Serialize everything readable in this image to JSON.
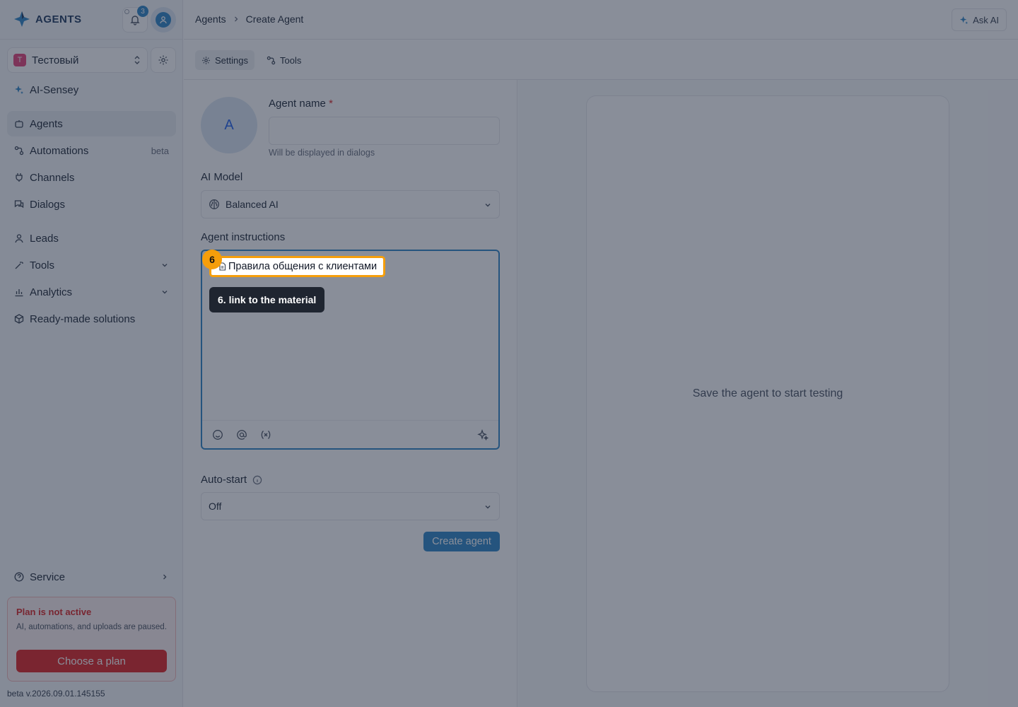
{
  "app": {
    "logo_text": "AGENTS"
  },
  "header": {
    "notifications_count": "3",
    "breadcrumb": [
      "Agents",
      "Create Agent"
    ],
    "ask_ai_label": "Ask AI"
  },
  "workspace": {
    "initial": "T",
    "name": "Тестовый"
  },
  "sidebar": {
    "items": [
      {
        "label": "AI-Sensey",
        "icon": "sparkle-icon"
      },
      {
        "label": "Agents",
        "icon": "bot-icon",
        "active": true
      },
      {
        "label": "Automations",
        "icon": "workflow-icon",
        "tail": "beta"
      },
      {
        "label": "Channels",
        "icon": "plug-icon"
      },
      {
        "label": "Dialogs",
        "icon": "chat-icon"
      },
      {
        "label": "Leads",
        "icon": "user-icon"
      },
      {
        "label": "Tools",
        "icon": "wand-icon"
      },
      {
        "label": "Analytics",
        "icon": "chart-icon"
      },
      {
        "label": "Ready-made solutions",
        "icon": "box-icon"
      },
      {
        "label": "Service",
        "icon": "help-icon"
      }
    ],
    "plan": {
      "title": "Plan is not active",
      "description": "AI, automations, and uploads are paused.",
      "button": "Choose a plan"
    },
    "version": "beta v.2026.09.01.145155"
  },
  "tabs": [
    {
      "label": "Settings",
      "active": true
    },
    {
      "label": "Tools"
    }
  ],
  "form": {
    "avatar_initial": "A",
    "agent_name_label": "Agent name",
    "required_mark": "*",
    "agent_name_value": "",
    "agent_name_hint": "Will be displayed in dialogs",
    "model_label": "AI Model",
    "model_value": "Balanced AI",
    "instructions_label": "Agent instructions",
    "instructions_mention": "Правила общения с клиентами",
    "autostart_label": "Auto-start",
    "autostart_value": "Off",
    "create_button": "Create agent"
  },
  "tour": {
    "step_number": "6",
    "tooltip": "6. link to the material"
  },
  "preview": {
    "message": "Save the agent to start testing"
  },
  "colors": {
    "accent": "#2f86c6",
    "highlight": "#f59e0b",
    "danger": "#e02424",
    "overlay": "#1c263c"
  }
}
